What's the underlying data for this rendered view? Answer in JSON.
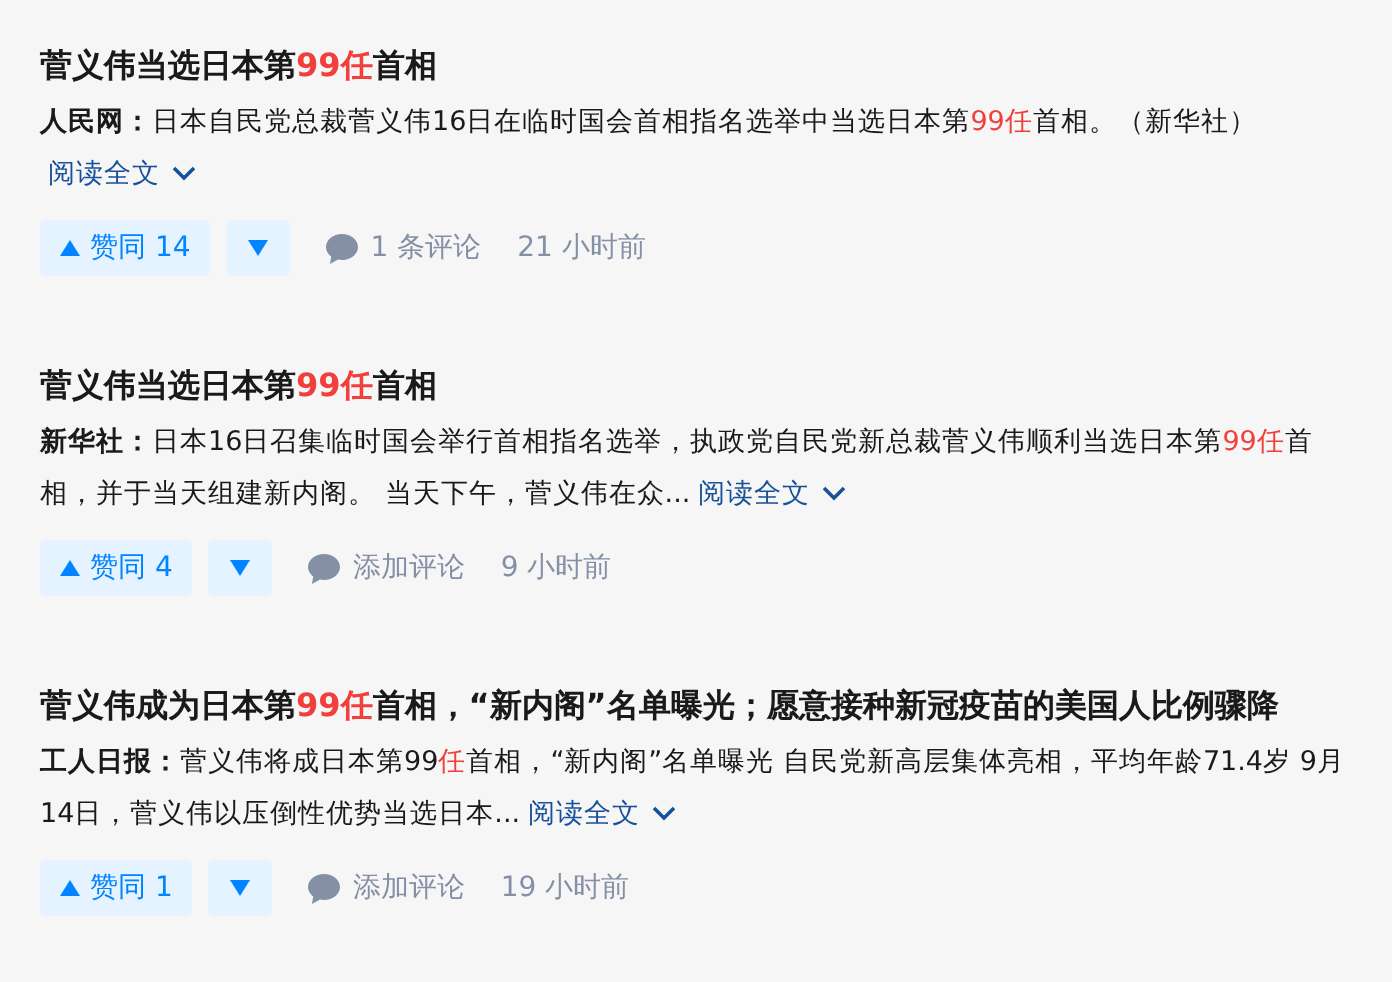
{
  "items": [
    {
      "title": [
        {
          "text": "菅义伟当选日本第",
          "highlight": false
        },
        {
          "text": "99任",
          "highlight": true
        },
        {
          "text": "首相",
          "highlight": false
        }
      ],
      "source": "人民网：",
      "excerpt": [
        {
          "text": "日本自民党总裁菅义伟16日在临时国会首相指名选举中当选日本第",
          "highlight": false
        },
        {
          "text": "99任",
          "highlight": true
        },
        {
          "text": "首相。（新华社）",
          "highlight": false
        }
      ],
      "read_more": "阅读全文",
      "upvote": "赞同 14",
      "comments": "1 条评论",
      "time": "21 小时前"
    },
    {
      "title": [
        {
          "text": "菅义伟当选日本第",
          "highlight": false
        },
        {
          "text": "99任",
          "highlight": true
        },
        {
          "text": "首相",
          "highlight": false
        }
      ],
      "source": "新华社：",
      "excerpt": [
        {
          "text": "日本16日召集临时国会举行首相指名选举，执政党自民党新总裁菅义伟顺利当选日本第",
          "highlight": false
        },
        {
          "text": "99任",
          "highlight": true
        },
        {
          "text": "首相，并于当天组建新内阁。 当天下午，菅义伟在众...",
          "highlight": false
        }
      ],
      "read_more": "阅读全文",
      "upvote": "赞同 4",
      "comments": "添加评论",
      "time": "9 小时前"
    },
    {
      "title": [
        {
          "text": "菅义伟成为日本第",
          "highlight": false
        },
        {
          "text": "99任",
          "highlight": true
        },
        {
          "text": "首相，“新内阁”名单曝光；愿意接种新冠疫苗的美国人比例骤降",
          "highlight": false
        }
      ],
      "source": "工人日报：",
      "excerpt": [
        {
          "text": "菅义伟将成日本第99",
          "highlight": false
        },
        {
          "text": "任",
          "highlight": true
        },
        {
          "text": "首相，“新内阁”名单曝光 自民党新高层集体亮相，平均年龄71.4岁 9月14日，菅义伟以压倒性优势当选日本...",
          "highlight": false
        }
      ],
      "read_more": "阅读全文",
      "upvote": "赞同 1",
      "comments": "添加评论",
      "time": "19 小时前"
    }
  ]
}
